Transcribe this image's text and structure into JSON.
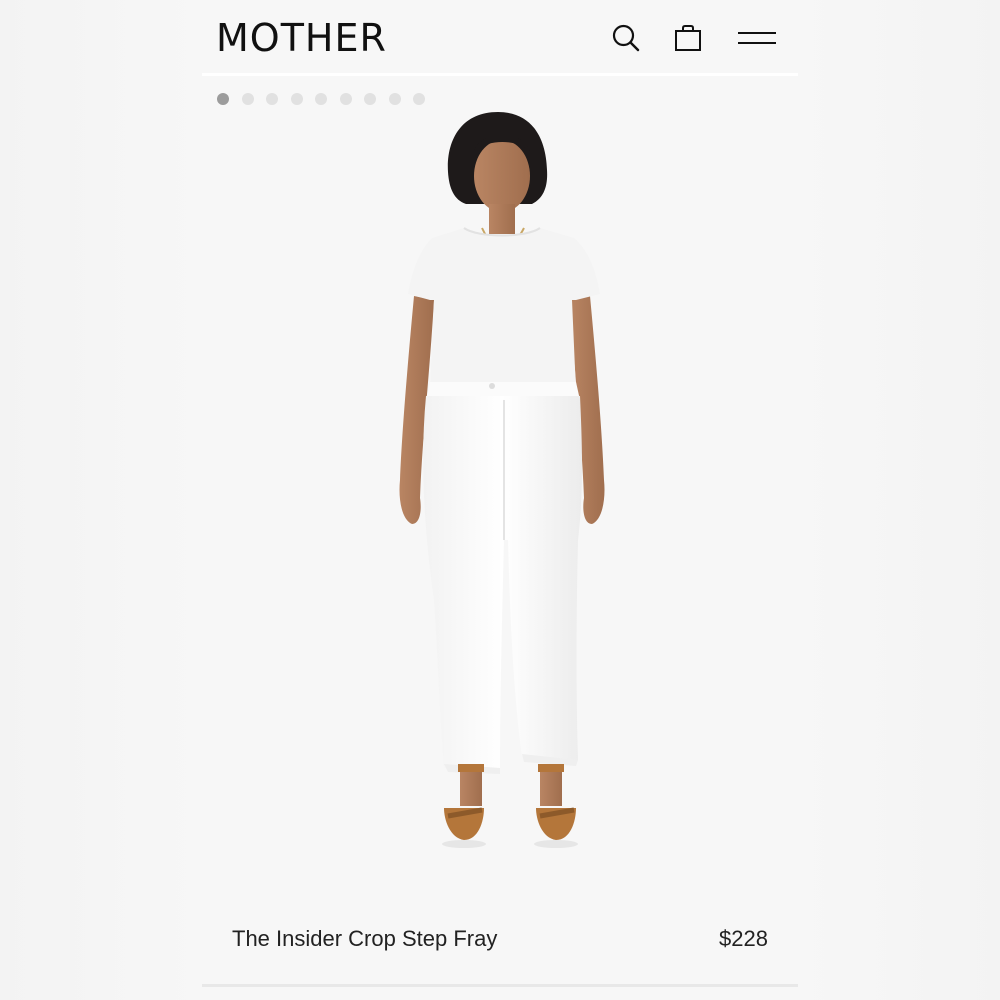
{
  "header": {
    "logo": "MOTHER",
    "icons": [
      "search-icon",
      "shopping-bag-icon",
      "hamburger-menu-icon"
    ]
  },
  "gallery": {
    "dot_count": 9,
    "active_index": 0
  },
  "product": {
    "name": "The Insider Crop Step Fray",
    "price": "$228"
  },
  "colors": {
    "background": "#f7f7f7",
    "text": "#111111",
    "dot_active": "#9c9c9c",
    "dot_inactive": "#e1e1e1",
    "denim": "#ffffff",
    "sandal": "#b4763a"
  }
}
